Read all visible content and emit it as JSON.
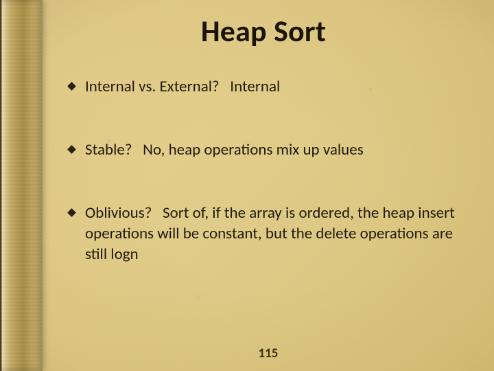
{
  "slide": {
    "title": "Heap Sort",
    "bullets": [
      {
        "question": "Internal vs. External?",
        "answer": "Internal"
      },
      {
        "question": "Stable?",
        "answer": "No, heap operations mix up values"
      },
      {
        "question": "Oblivious?",
        "answer": "Sort of, if the array is ordered, the heap insert operations will be constant, but the delete operations are still logn"
      }
    ],
    "page_number": "115"
  }
}
